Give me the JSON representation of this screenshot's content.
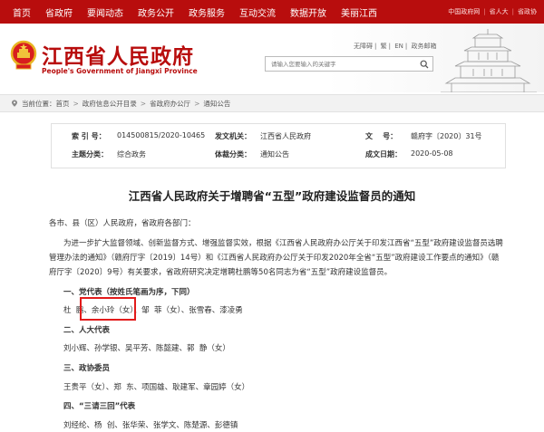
{
  "nav": {
    "items": [
      "首页",
      "省政府",
      "要闻动态",
      "政务公开",
      "政务服务",
      "互动交流",
      "数据开放",
      "美丽江西"
    ],
    "right_links": [
      "中国政府网",
      "省人大",
      "省政协"
    ]
  },
  "header": {
    "title": "江西省人民政府",
    "subtitle": "People's Government of Jiangxi Province",
    "util_links": [
      "无障碍",
      "繁",
      "EN",
      "政务邮箱"
    ],
    "search_placeholder": "请输入您要输入的关键字"
  },
  "breadcrumb": {
    "label": "当前位置：",
    "items": [
      "首页",
      "政府信息公开目录",
      "省政府办公厅",
      "通知公告"
    ]
  },
  "meta": {
    "index_label": "索 引 号：",
    "index_value": "014500815/2020-10465",
    "issuer_label": "发文机关：",
    "issuer_value": "江西省人民政府",
    "docno_label": "文    号：",
    "docno_value": "赣府字〔2020〕31号",
    "topic_label": "主题分类：",
    "topic_value": "综合政务",
    "genre_label": "体裁分类：",
    "genre_value": "通知公告",
    "date_label": "成文日期：",
    "date_value": "2020-05-08"
  },
  "article": {
    "title": "江西省人民政府关于增聘省“五型”政府建设监督员的通知",
    "greeting": "各市、县（区）人民政府，省政府各部门：",
    "para1_line1": "为进一步扩大监督领域、创新监督方式、增强监督实效，根据《江西省人民政府办公厅关于印发江西省“五型”政府建设监督员选聘",
    "para1_line2": "管理办法的通知》（赣府厅字〔2019〕14号）和《江西省人民政府办公厅关于印发2020年全省“五型”政府建设工作要点的通知》（赣",
    "para1_line3": "府厅字〔2020〕9号）有关要求，省政府研究决定增聘杜鹏等50名同志为省“五型”政府建设监督员。",
    "sections": [
      {
        "heading": "一、党代表（按姓氏笔画为序，下同）",
        "names": "杜  鹏、余小玲（女）、邹  菲（女）、张雪春、漆凌勇"
      },
      {
        "heading": "二、人大代表",
        "names": "刘小辉、孙学银、吴平芳、陈懿建、郭  静（女）"
      },
      {
        "heading": "三、政协委员",
        "names": "王贵平（女）、郑  东、项国雄、耿建军、章园婷（女）"
      },
      {
        "heading": "四、“三请三回”代表",
        "names": "刘经纶、杨  创、张华荣、张学文、陈楚源、彭德镇"
      }
    ]
  },
  "colors": {
    "brand_red": "#b80d0d",
    "highlight_red": "#e21b1b"
  }
}
